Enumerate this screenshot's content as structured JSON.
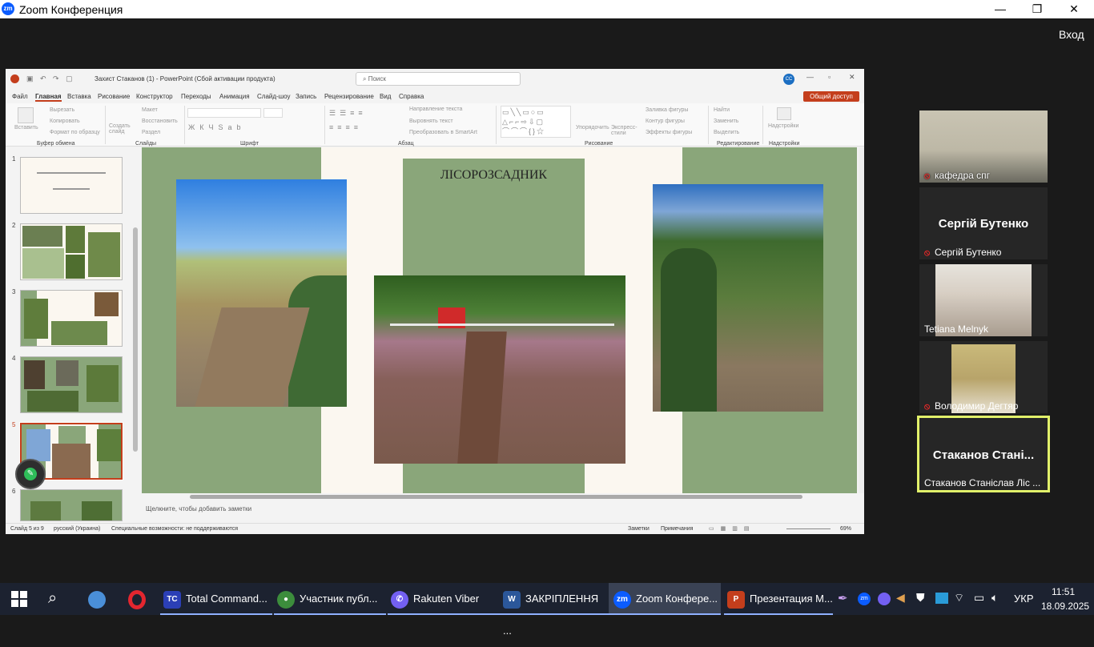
{
  "zoom": {
    "title": "Zoom Конференция",
    "logo": "zm",
    "sign_in": "Вход",
    "window_buttons": [
      "—",
      "❐",
      "✕"
    ]
  },
  "ppt": {
    "title": "Захист Стаканов (1) - PowerPoint (Сбой активации продукта)",
    "search_placeholder": "Поиск",
    "user_badge": "CC",
    "tabs": [
      "Файл",
      "Главная",
      "Вставка",
      "Рисование",
      "Конструктор",
      "Переходы",
      "Анимация",
      "Слайд-шоу",
      "Запись",
      "Рецензирование",
      "Вид",
      "Справка"
    ],
    "active_tab": "Главная",
    "share": "Общий доступ",
    "ribbon": {
      "paste": "Вставить",
      "cut": "Вырезать",
      "copy": "Копировать",
      "format_painter": "Формат по образцу",
      "new_slide": "Создать слайд",
      "layout": "Макет",
      "reset": "Восстановить",
      "section": "Раздел",
      "text_direction": "Направление текста",
      "align_text": "Выровнять текст",
      "smartart": "Преобразовать в SmartArt",
      "arrange": "Упорядочить",
      "quick_styles": "Экспресс-стили",
      "shape_fill": "Заливка фигуры",
      "shape_outline": "Контур фигуры",
      "shape_effects": "Эффекты фигуры",
      "find": "Найти",
      "replace": "Заменить",
      "select": "Выделить",
      "addins": "Надстройки"
    },
    "groups": [
      "Буфер обмена",
      "Слайды",
      "Шрифт",
      "Абзац",
      "Рисование",
      "Редактирование",
      "Надстройки"
    ],
    "slide_numbers": [
      "1",
      "2",
      "3",
      "4",
      "5",
      "6"
    ],
    "slide_title": "ЛІСОРОЗСАДНИК",
    "notes": "Щелкните, чтобы добавить заметки",
    "status": {
      "slide": "Слайд 5 из 9",
      "language": "русский (Украина)",
      "accessibility": "Специальные возможности: не поддерживаются",
      "notes_btn": "Заметки",
      "comments_btn": "Примечания",
      "zoom": "69%"
    }
  },
  "participants": [
    {
      "name": "кафедра спг",
      "muted": true,
      "video": true
    },
    {
      "name": "Сергій Бутенко",
      "display": "Сергій Бутенко",
      "muted": true,
      "video": false
    },
    {
      "name": "Tetiana Melnyk",
      "muted": false,
      "video": true
    },
    {
      "name": "Володимир Дегтяр",
      "muted": true,
      "video": true
    },
    {
      "name": "Стаканов Станіслав Ліс ...",
      "display": "Стаканов  Стані...",
      "muted": false,
      "video": false,
      "active_speaker": true
    }
  ],
  "taskbar": {
    "apps": [
      {
        "label": "Total Command...",
        "icon": "TC",
        "color": "#2b3fb6"
      },
      {
        "label": "Участник публ...",
        "icon": "●",
        "color": "#3c8d3c"
      },
      {
        "label": "Rakuten Viber",
        "icon": "✆",
        "color": "#7360f2"
      },
      {
        "label": "ЗАКРІПЛЕННЯ ...",
        "icon": "W",
        "color": "#2b579a"
      },
      {
        "label": "Zoom Конфере...",
        "icon": "zm",
        "color": "#0b5cff"
      },
      {
        "label": "Презентация М...",
        "icon": "P",
        "color": "#c43e1c"
      }
    ],
    "language": "УКР",
    "time": "11:51",
    "date": "18.09.2025"
  }
}
